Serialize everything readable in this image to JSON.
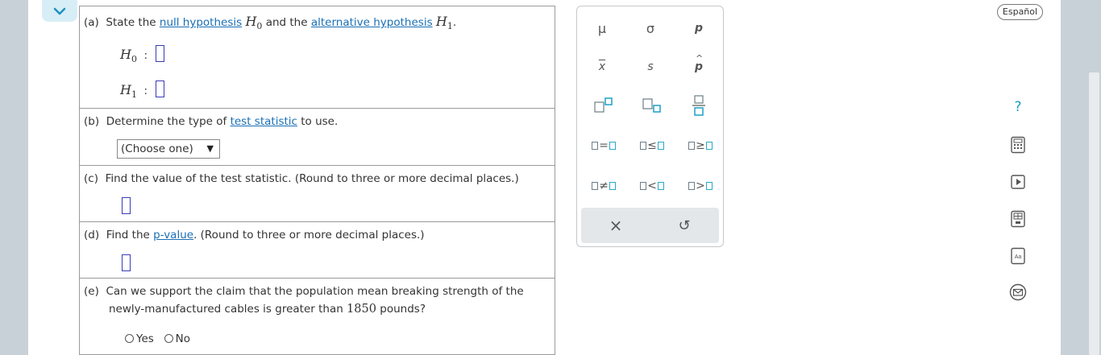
{
  "parts": {
    "a": {
      "prefix": "(a)",
      "text1": "State the",
      "link1": "null hypothesis",
      "h0": "H",
      "h0sub": "0",
      "and": "and the",
      "link2": "alternative hypothesis",
      "h1": "H",
      "h1sub": "1",
      "end": ".",
      "h0_label": "H",
      "h0_label_sub": "0",
      "h1_label": "H",
      "h1_label_sub": "1",
      "colon": ":"
    },
    "b": {
      "prefix": "(b)",
      "text1": "Determine the type of",
      "link": "test statistic",
      "text2": "to use.",
      "select_value": "(Choose one)",
      "select_arrow": "▼"
    },
    "c": {
      "prefix": "(c)",
      "text": "Find the value of the test statistic. (Round to three or more decimal places.)"
    },
    "d": {
      "prefix": "(d)",
      "text1": "Find the",
      "link": "p-value",
      "text2": ". (Round to three or more decimal places.)"
    },
    "e": {
      "prefix": "(e)",
      "line1": "Can we support the claim that the population mean breaking strength of the",
      "line2_start": "newly-manufactured cables is greater than",
      "value": "1850",
      "line2_end": "pounds?",
      "yes": "Yes",
      "no": "No"
    }
  },
  "palette": {
    "mu": "μ",
    "sigma": "σ",
    "p": "p",
    "xbar": "x",
    "s": "s",
    "phat": "p",
    "eq": "=",
    "le": "≤",
    "ge": "≥",
    "ne": "≠",
    "lt": "<",
    "gt": ">",
    "clear": "×",
    "undo": "↺"
  },
  "sidebar": {
    "language": "Español",
    "help": "?"
  },
  "colors": {
    "accent": "#2aa7c8",
    "link": "#1a6fb5",
    "gutter": "#c8d1d7"
  }
}
